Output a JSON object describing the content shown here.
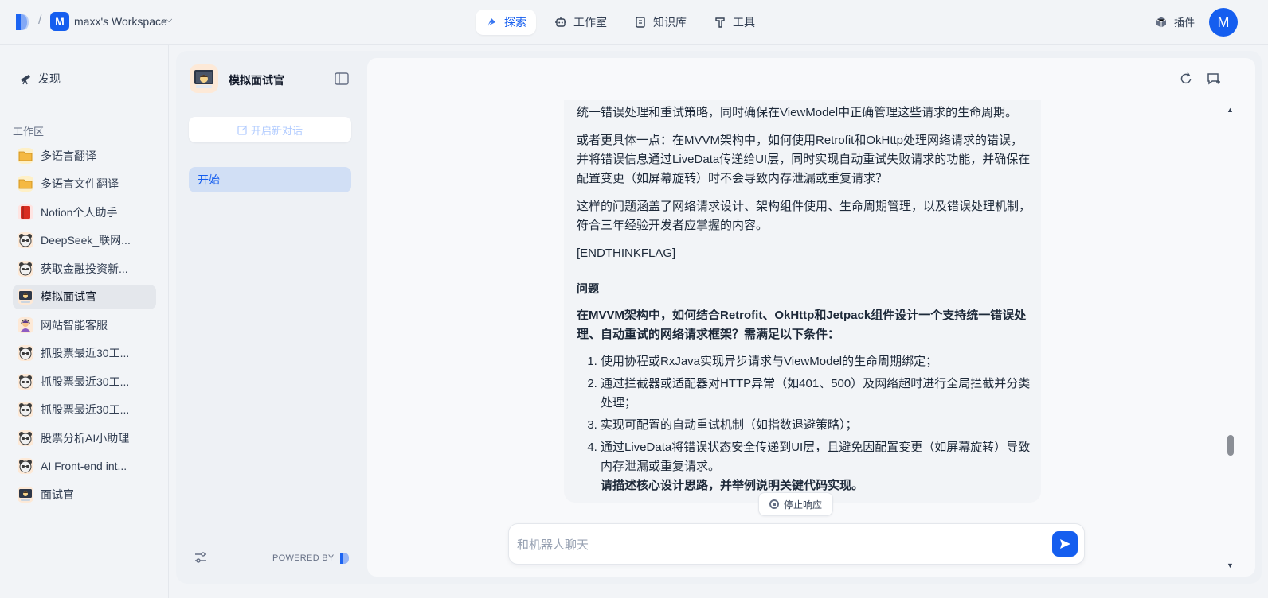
{
  "topbar": {
    "workspace_initial": "M",
    "workspace_name": "maxx's Workspace",
    "nav": [
      {
        "label": "探索",
        "icon": "compass-icon",
        "active": true
      },
      {
        "label": "工作室",
        "icon": "robot-icon",
        "active": false
      },
      {
        "label": "知识库",
        "icon": "book-icon",
        "active": false
      },
      {
        "label": "工具",
        "icon": "hammer-icon",
        "active": false
      }
    ],
    "plugin_label": "插件",
    "user_initial": "M"
  },
  "sidebar": {
    "discover_label": "发现",
    "workspace_label": "工作区",
    "apps": [
      {
        "label": "多语言翻译",
        "icon": "folder-icon"
      },
      {
        "label": "多语言文件翻译",
        "icon": "folder-icon"
      },
      {
        "label": "Notion个人助手",
        "icon": "book-red-icon"
      },
      {
        "label": "DeepSeek_联网...",
        "icon": "bear-icon"
      },
      {
        "label": "获取金融投资新...",
        "icon": "bear-icon"
      },
      {
        "label": "模拟面试官",
        "icon": "monitor-icon",
        "active": true
      },
      {
        "label": "网站智能客服",
        "icon": "support-agent-icon"
      },
      {
        "label": "抓股票最近30工...",
        "icon": "bear-icon"
      },
      {
        "label": "抓股票最近30工...",
        "icon": "bear-icon"
      },
      {
        "label": "抓股票最近30工...",
        "icon": "bear-icon"
      },
      {
        "label": "股票分析AI小助理",
        "icon": "bear-icon"
      },
      {
        "label": "AI Front-end int...",
        "icon": "bear-icon"
      },
      {
        "label": "面试官",
        "icon": "monitor-icon"
      }
    ]
  },
  "app_panel": {
    "bot_name": "模拟面试官",
    "new_chat_label": "开启新对话",
    "conversation": "开始",
    "powered_by": "POWERED BY"
  },
  "chat": {
    "p1": "统一错误处理和重试策略，同时确保在ViewModel中正确管理这些请求的生命周期。",
    "p2": "或者更具体一点：在MVVM架构中，如何使用Retrofit和OkHttp处理网络请求的错误，并将错误信息通过LiveData传递给UI层，同时实现自动重试失败请求的功能，并确保在配置变更（如屏幕旋转）时不会导致内存泄漏或重复请求？",
    "p3": "这样的问题涵盖了网络请求设计、架构组件使用、生命周期管理，以及错误处理机制，符合三年经验开发者应掌握的内容。",
    "p4": "[ENDTHINKFLAG]",
    "heading": "问题",
    "question": "在MVVM架构中，如何结合Retrofit、OkHttp和Jetpack组件设计一个支持统一错误处理、自动重试的网络请求框架？需满足以下条件：",
    "items": [
      "使用协程或RxJava实现异步请求与ViewModel的生命周期绑定；",
      "通过拦截器或适配器对HTTP异常（如401、500）及网络超时进行全局拦截并分类处理；",
      "实现可配置的自动重试机制（如指数退避策略）；",
      "通过LiveData将错误状态安全传递到UI层，且避免因配置变更（如屏幕旋转）导致内存泄漏或重复请求。"
    ],
    "closing": "请描述核心设计思路，并举例说明关键代码实现。",
    "stop_label": "停止响应",
    "input_placeholder": "和机器人聊天"
  },
  "colors": {
    "accent": "#155eef",
    "active_conv_bg": "#d1dff5"
  }
}
